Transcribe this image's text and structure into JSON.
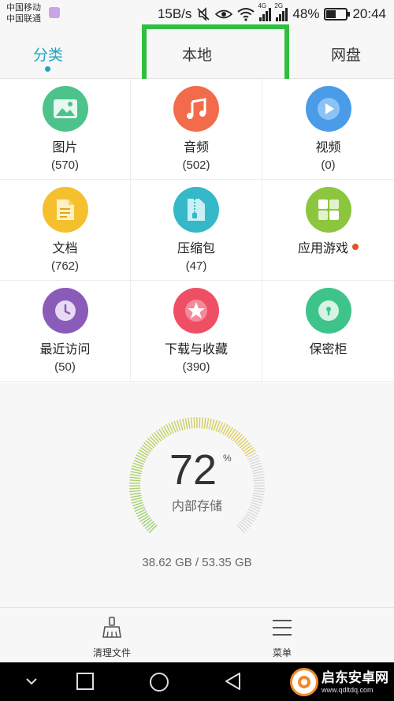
{
  "status_bar": {
    "carrier_1": "中国移动",
    "carrier_2": "中国联通",
    "speed": "15B/s",
    "net_4g": "4G",
    "net_2g": "2G",
    "battery": "48%",
    "time": "20:44"
  },
  "tabs": [
    {
      "label": "分类"
    },
    {
      "label": "本地"
    },
    {
      "label": "网盘"
    }
  ],
  "categories": [
    {
      "name": "图片",
      "count": "(570)",
      "color": "#4cc38a",
      "icon": "image-icon"
    },
    {
      "name": "音频",
      "count": "(502)",
      "color": "#f26b4a",
      "icon": "music-icon"
    },
    {
      "name": "视频",
      "count": "(0)",
      "color": "#4a9be8",
      "icon": "play-icon"
    },
    {
      "name": "文档",
      "count": "(762)",
      "color": "#f5c02e",
      "icon": "document-icon"
    },
    {
      "name": "压缩包",
      "count": "(47)",
      "color": "#35b8c8",
      "icon": "zip-icon"
    },
    {
      "name": "应用游戏",
      "count": "",
      "color": "#8cc63f",
      "icon": "apps-icon"
    },
    {
      "name": "最近访问",
      "count": "(50)",
      "color": "#8a5bb8",
      "icon": "clock-icon"
    },
    {
      "name": "下载与收藏",
      "count": "(390)",
      "color": "#ef4f64",
      "icon": "star-icon"
    },
    {
      "name": "保密柜",
      "count": "",
      "color": "#3ec48a",
      "icon": "lock-icon"
    }
  ],
  "storage": {
    "percent_value": 72,
    "percent": "72",
    "percent_sign": "%",
    "label": "内部存储",
    "size": "38.62 GB / 53.35 GB"
  },
  "toolbar": {
    "clean_label": "清理文件",
    "menu_label": "菜单"
  },
  "watermark": {
    "title": "启东安卓网",
    "url": "www.qdltdq.com"
  },
  "colors": {
    "accent": "#1aa5c6",
    "highlight": "#2fbf3f"
  }
}
